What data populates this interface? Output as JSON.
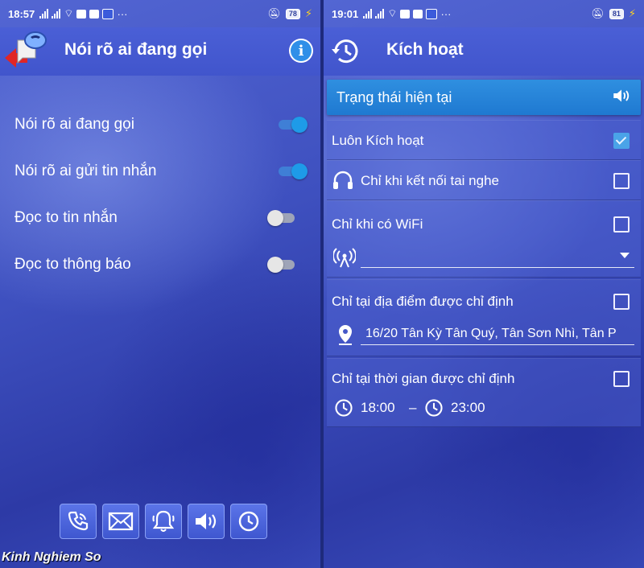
{
  "left_screen": {
    "statusbar": {
      "time": "18:57",
      "battery": "78"
    },
    "appbar": {
      "title": "Nói rõ ai đang gọi",
      "logo_icon": "speech-bubble-icon",
      "info_icon": "info-icon"
    },
    "switches": [
      {
        "label": "Nói rõ ai đang gọi",
        "on": true
      },
      {
        "label": "Nói rõ ai gửi tin nhắn",
        "on": true
      },
      {
        "label": "Đọc to tin nhắn",
        "on": false
      },
      {
        "label": "Đọc to thông báo",
        "on": false
      }
    ],
    "bottom_nav": [
      {
        "icon": "phone-icon"
      },
      {
        "icon": "envelope-icon"
      },
      {
        "icon": "bell-icon"
      },
      {
        "icon": "speaker-icon"
      },
      {
        "icon": "clock-icon"
      }
    ],
    "watermark": "Kinh Nghiem So"
  },
  "right_screen": {
    "statusbar": {
      "time": "19:01",
      "battery": "81"
    },
    "appbar": {
      "title": "Kích hoạt",
      "history_icon": "history-icon"
    },
    "status_banner": {
      "label": "Trạng thái hiện tại",
      "icon": "speaker-icon"
    },
    "options": {
      "always": {
        "label": "Luôn Kích hoạt",
        "checked": true
      },
      "headphones": {
        "label": "Chỉ khi kết nối tai nghe",
        "checked": false,
        "icon": "headphones-icon"
      },
      "wifi": {
        "label": "Chỉ khi có WiFi",
        "checked": false,
        "icon": "wifi-tower-icon",
        "value": ""
      },
      "location": {
        "label": "Chỉ tại địa điểm được chỉ định",
        "checked": false,
        "icon": "location-pin-icon",
        "address": "16/20 Tân Kỳ Tân Quý, Tân Sơn Nhì, Tân P"
      },
      "time": {
        "label": "Chỉ tại thời gian được chỉ định",
        "checked": false,
        "start": "18:00",
        "separator": "–",
        "end": "23:00"
      }
    }
  }
}
